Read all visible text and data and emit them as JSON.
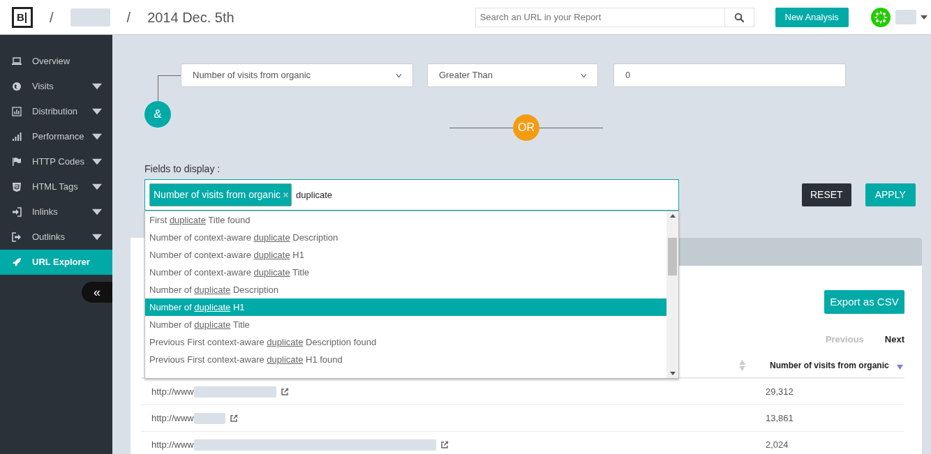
{
  "header": {
    "logo": "B",
    "breadcrumb": [
      {
        "kind": "separator",
        "text": "/"
      },
      {
        "kind": "redacted"
      },
      {
        "kind": "separator",
        "text": "/"
      },
      {
        "kind": "text",
        "text": "2014 Dec. 5th"
      }
    ],
    "search": {
      "placeholder": "Search an URL in your Report"
    },
    "new_button": "New Analysis"
  },
  "sidebar": {
    "items": [
      {
        "label": "Overview",
        "expandable": false,
        "selected": false
      },
      {
        "label": "Visits",
        "expandable": true,
        "selected": false
      },
      {
        "label": "Distribution",
        "expandable": true,
        "selected": false
      },
      {
        "label": "Performance",
        "expandable": true,
        "selected": false
      },
      {
        "label": "HTTP Codes",
        "expandable": true,
        "selected": false
      },
      {
        "label": "HTML Tags",
        "expandable": true,
        "selected": false
      },
      {
        "label": "Inlinks",
        "expandable": true,
        "selected": false
      },
      {
        "label": "Outlinks",
        "expandable": true,
        "selected": false
      },
      {
        "label": "URL Explorer",
        "expandable": false,
        "selected": true
      }
    ],
    "collapse_button": "«"
  },
  "filter": {
    "field": "Number of visits from organic",
    "operator": "Greater Than",
    "value": "0",
    "and_label": "&",
    "or_label": "OR"
  },
  "fields_to_display": {
    "label": "Fields to display :",
    "tags": [
      "Number of visits from organic"
    ],
    "typed": "duplicate",
    "suggestions": [
      {
        "before": "First ",
        "match": "duplicate",
        "after": " Title found",
        "selected": false
      },
      {
        "before": "Number of context-aware ",
        "match": "duplicate",
        "after": " Description",
        "selected": false
      },
      {
        "before": "Number of context-aware ",
        "match": "duplicate",
        "after": " H1",
        "selected": false
      },
      {
        "before": "Number of context-aware ",
        "match": "duplicate",
        "after": " Title",
        "selected": false
      },
      {
        "before": "Number of ",
        "match": "duplicate",
        "after": " Description",
        "selected": false
      },
      {
        "before": "Number of ",
        "match": "duplicate",
        "after": " H1",
        "selected": true
      },
      {
        "before": "Number of ",
        "match": "duplicate",
        "after": " Title",
        "selected": false
      },
      {
        "before": "Previous First context-aware ",
        "match": "duplicate",
        "after": " Description found",
        "selected": false
      },
      {
        "before": "Previous First context-aware ",
        "match": "duplicate",
        "after": " H1 found",
        "selected": false
      }
    ]
  },
  "buttons": {
    "reset": "RESET",
    "apply": "APPLY"
  },
  "results": {
    "export_button": "Export as CSV",
    "previous": "Previous",
    "next": "Next",
    "columns": [
      {
        "sorted": false
      },
      {
        "label": "Number of visits from organic",
        "sorted": true
      }
    ],
    "rows": [
      {
        "url": "http://www",
        "value": "29,312"
      },
      {
        "url": "http://www",
        "value": "13,861"
      },
      {
        "url": "http://www",
        "value": "2,024"
      }
    ]
  }
}
